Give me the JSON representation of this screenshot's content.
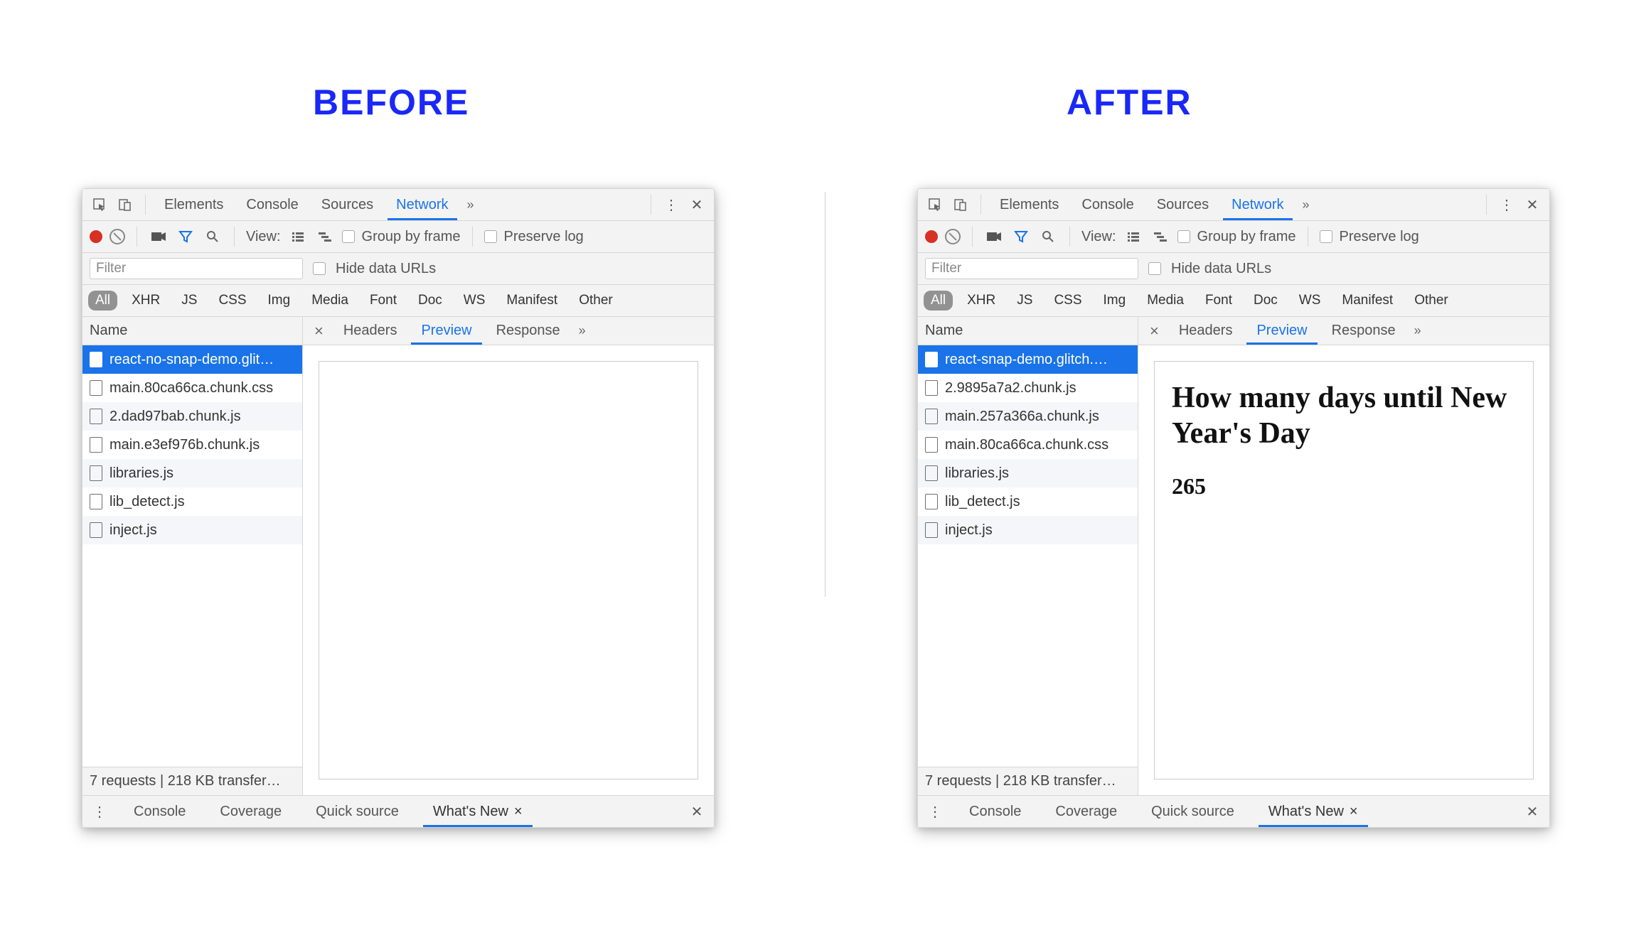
{
  "titles": {
    "before": "BEFORE",
    "after": "AFTER"
  },
  "main_tabs": {
    "elements": "Elements",
    "console": "Console",
    "sources": "Sources",
    "network": "Network"
  },
  "toolbar2": {
    "view": "View:",
    "group": "Group by frame",
    "preserve": "Preserve log"
  },
  "filter": {
    "placeholder": "Filter",
    "hide_data_urls": "Hide data URLs"
  },
  "types": {
    "all": "All",
    "xhr": "XHR",
    "js": "JS",
    "css": "CSS",
    "img": "Img",
    "media": "Media",
    "font": "Font",
    "doc": "Doc",
    "ws": "WS",
    "manifest": "Manifest",
    "other": "Other"
  },
  "req_header": "Name",
  "detail_tabs": {
    "headers": "Headers",
    "preview": "Preview",
    "response": "Response"
  },
  "requests_before": [
    "react-no-snap-demo.glit…",
    "main.80ca66ca.chunk.css",
    "2.dad97bab.chunk.js",
    "main.e3ef976b.chunk.js",
    "libraries.js",
    "lib_detect.js",
    "inject.js"
  ],
  "requests_after": [
    "react-snap-demo.glitch.…",
    "2.9895a7a2.chunk.js",
    "main.257a366a.chunk.js",
    "main.80ca66ca.chunk.css",
    "libraries.js",
    "lib_detect.js",
    "inject.js"
  ],
  "preview_after": {
    "heading": "How many days until New Year's Day",
    "number": "265"
  },
  "status": "7 requests | 218 KB transfer…",
  "drawer": {
    "console": "Console",
    "coverage": "Coverage",
    "quick": "Quick source",
    "whatsnew": "What's New"
  }
}
